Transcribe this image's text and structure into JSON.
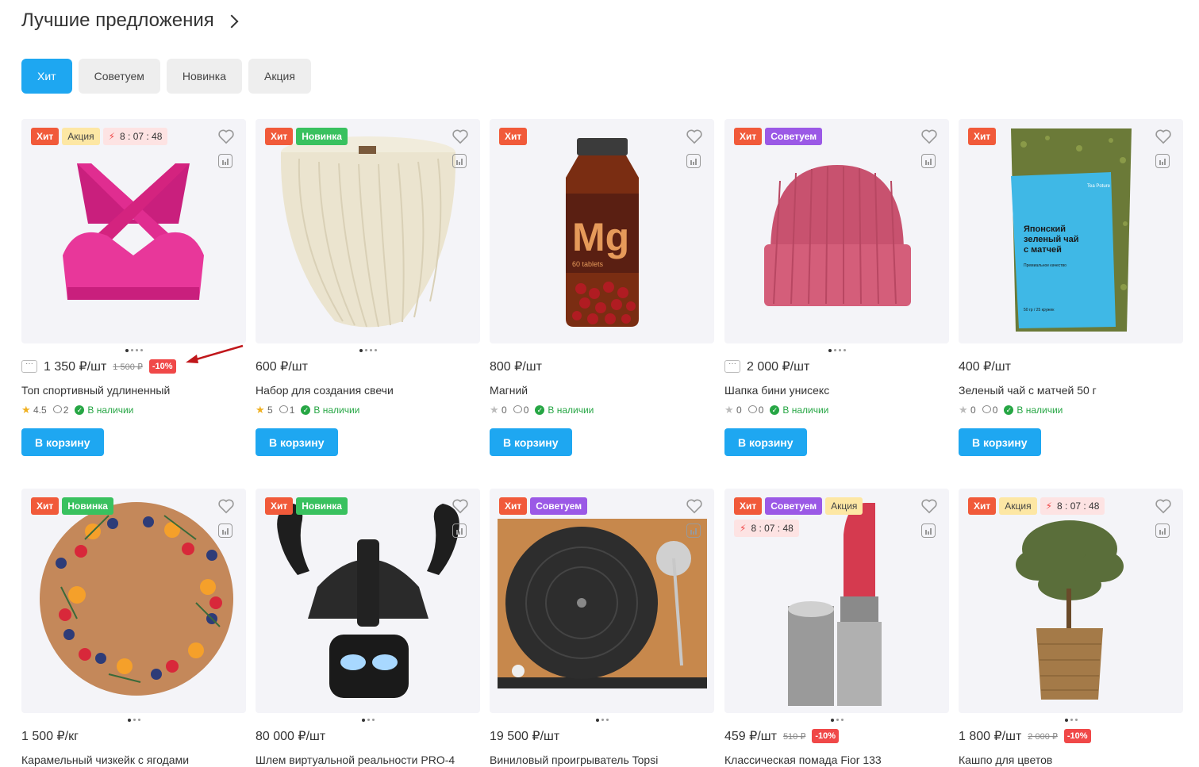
{
  "header": {
    "title": "Лучшие предложения"
  },
  "tabs": [
    "Хит",
    "Советуем",
    "Новинка",
    "Акция"
  ],
  "buy_label": "В корзину",
  "in_stock": "В наличии",
  "badges": {
    "hit": "Хит",
    "new": "Новинка",
    "advise": "Советуем",
    "sale": "Акция",
    "timer": "8 : 07 : 48"
  },
  "products": [
    {
      "price": "1 350 ₽/шт",
      "old_price": "1 500 ₽",
      "discount": "-10%",
      "title": "Топ спортивный удлиненный",
      "rating": "4.5",
      "reviews": "2"
    },
    {
      "price": "600 ₽/шт",
      "title": "Набор для создания свечи",
      "rating": "5",
      "reviews": "1"
    },
    {
      "price": "800 ₽/шт",
      "title": "Магний",
      "rating": "0",
      "reviews": "0",
      "label_mg": "Mg",
      "label_tabs": "60 tablets"
    },
    {
      "price": "2 000 ₽/шт",
      "title": "Шапка бини унисекс",
      "rating": "0",
      "reviews": "0"
    },
    {
      "price": "400 ₽/шт",
      "title": "Зеленый чай с матчей 50 г",
      "rating": "0",
      "reviews": "0",
      "pack_brand": "Tea Poture",
      "pack_text": "Японский зеленый чай с матчей",
      "pack_sub": "Премиальное качество",
      "pack_foot": "50 гр / 25 кружек"
    },
    {
      "price": "1 500 ₽/кг",
      "title": "Карамельный чизкейк с ягодами"
    },
    {
      "price": "80 000 ₽/шт",
      "title": "Шлем виртуальной реальности PRO-4"
    },
    {
      "price": "19 500 ₽/шт",
      "title": "Виниловый проигрыватель Topsi"
    },
    {
      "price": "459 ₽/шт",
      "old_price": "510 ₽",
      "discount": "-10%",
      "title": "Классическая помада Fior 133"
    },
    {
      "price": "1 800 ₽/шт",
      "old_price": "2 000 ₽",
      "discount": "-10%",
      "title": "Кашпо для цветов"
    }
  ],
  "colors": {
    "accent": "#1ea7f1",
    "hit": "#f15a3a",
    "new": "#39c15f",
    "advise": "#9b59e6",
    "sale": "#fde7a4",
    "discount": "#f04848",
    "stock": "#26a644"
  }
}
